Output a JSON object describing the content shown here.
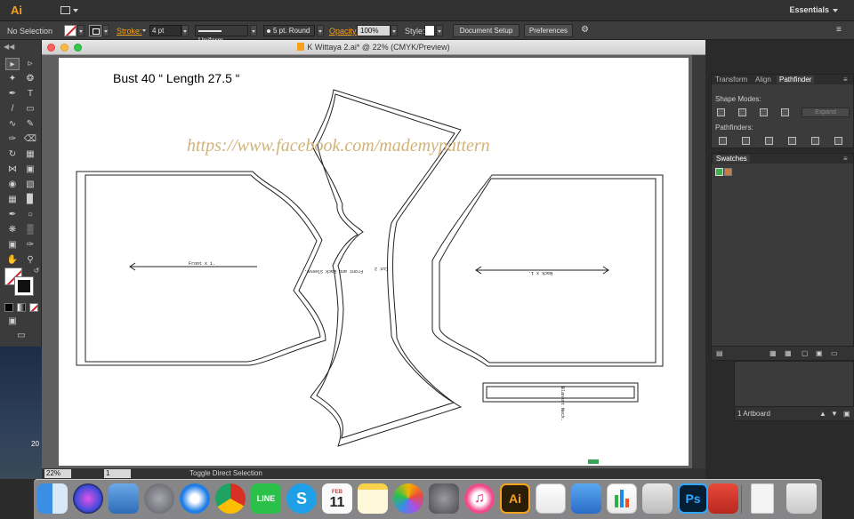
{
  "app": {
    "logo": "Ai",
    "workspace": "Essentials"
  },
  "control_bar": {
    "selection_status": "No Selection",
    "stroke_label": "Stroke:",
    "stroke_weight": "4 pt",
    "profile": "Uniform",
    "brush": "5 pt. Round",
    "opacity_label": "Opacity:",
    "opacity_value": "100%",
    "style_label": "Style:",
    "document_setup": "Document Setup",
    "preferences": "Preferences"
  },
  "document": {
    "title": "K Wittaya 2.ai* @ 22% (CMYK/Preview)",
    "artboard_text": {
      "measurements": "Bust 40 “ Length 27.5 “",
      "watermark_url": "https://www.facebook.com/mademypattern"
    },
    "pattern_labels": {
      "front": "Front x 1.",
      "back": "Back x 1.",
      "sleeve": "Front and Back Sleeve.",
      "sleeve_cut": "Cut 2",
      "neck": "Blanket Neck."
    }
  },
  "status_bar": {
    "zoom": "22%",
    "artboard_number": "1",
    "current_tool": "Toggle Direct Selection"
  },
  "panels": {
    "pathfinder": {
      "tabs": [
        "Transform",
        "Align",
        "Pathfinder"
      ],
      "active_tab": "Pathfinder",
      "shape_modes_label": "Shape Modes:",
      "pathfinders_label": "Pathfinders:",
      "expand_label": "Expand"
    },
    "swatches": {
      "tab": "Swatches"
    },
    "artboards": {
      "count_label": "1 Artboard"
    }
  },
  "desktop": {
    "year_fragment": "20"
  },
  "dock": {
    "items": [
      "finder-icon",
      "siri-icon",
      "preview-icon",
      "launchpad-icon",
      "safari-icon",
      "chrome-icon",
      "line-icon",
      "skype-icon",
      "calendar-icon",
      "notes-icon",
      "photos-icon",
      "system-preferences-icon",
      "itunes-icon",
      "illustrator-icon",
      "textedit-icon",
      "keynote-icon",
      "numbers-icon",
      "calculator-icon",
      "photoshop-icon",
      "parallels-icon",
      "zip-file-icon",
      "trash-icon"
    ],
    "calendar_month": "FEB",
    "calendar_day": "11",
    "illustrator_label": "Ai",
    "photoshop_label": "Ps"
  },
  "colors": {
    "illustrator_orange": "#f7a21b",
    "watermark": "#d2b377",
    "photoshop_blue": "#31a8ff"
  }
}
